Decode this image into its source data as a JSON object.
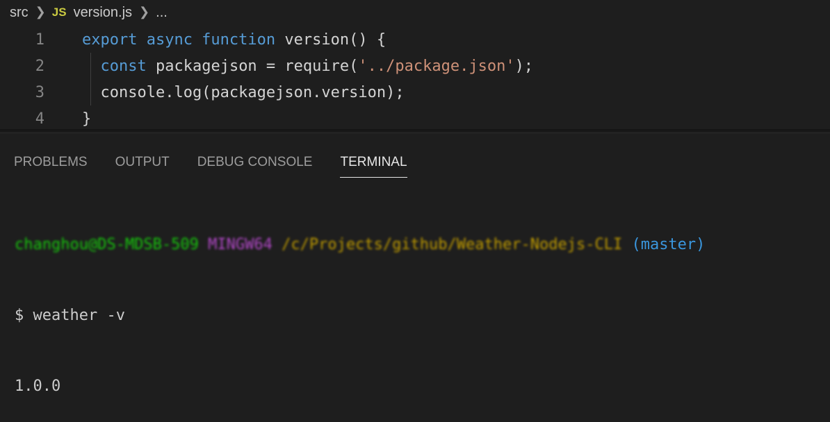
{
  "breadcrumb": {
    "folder": "src",
    "file_icon": "JS",
    "file": "version.js",
    "more": "..."
  },
  "editor": {
    "lines": [
      {
        "num": "1",
        "tokens": [
          {
            "t": "kw",
            "v": "export async function "
          },
          {
            "t": "fn",
            "v": "version() {"
          }
        ]
      },
      {
        "num": "2",
        "tokens": [
          {
            "t": "plain",
            "v": "  "
          },
          {
            "t": "kw",
            "v": "const "
          },
          {
            "t": "fn",
            "v": "packagejson = require("
          },
          {
            "t": "str",
            "v": "'../package.json'"
          },
          {
            "t": "fn",
            "v": ");"
          }
        ]
      },
      {
        "num": "3",
        "tokens": [
          {
            "t": "fn",
            "v": "  console.log(packagejson.version);"
          }
        ]
      },
      {
        "num": "4",
        "tokens": [
          {
            "t": "fn",
            "v": "}"
          }
        ]
      }
    ]
  },
  "panel": {
    "tabs": [
      "PROBLEMS",
      "OUTPUT",
      "DEBUG CONSOLE",
      "TERMINAL"
    ],
    "active_tab": "TERMINAL"
  },
  "terminal": {
    "prompt_user": "changhou@DS-MDSB-509",
    "prompt_msys": "MINGW64",
    "prompt_path": "/c/Projects/github/Weather-Nodejs-CLI",
    "prompt_branch": "(master)",
    "command": "$ weather -v",
    "output": "1.0.0"
  },
  "colors": {
    "background": "#1e1e1e",
    "keyword": "#569cd6",
    "string": "#ce9178",
    "terminal_user": "#16c60c",
    "terminal_msys": "#b148c6",
    "terminal_path": "#c19c00",
    "terminal_branch": "#3a96dd"
  }
}
